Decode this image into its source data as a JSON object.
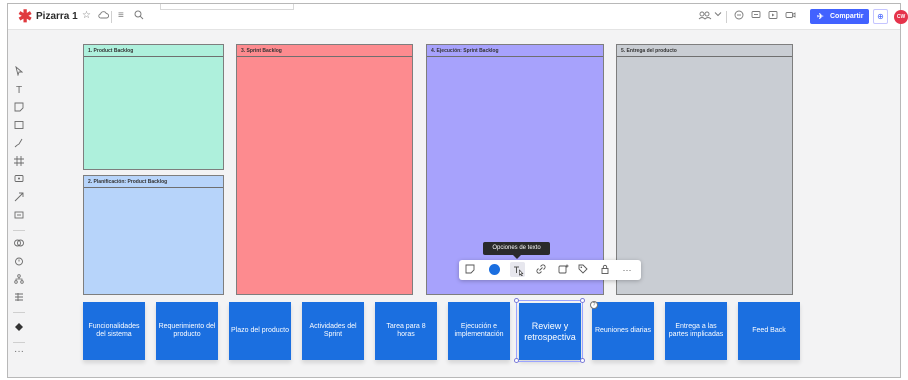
{
  "app": {
    "board_title": "Pizarra 1",
    "share_label": "Compartir",
    "avatar_initials": "CW",
    "accent_color": "#4262ff",
    "logo_icon": "asterisk-logo"
  },
  "topbar_icons": [
    "star-icon",
    "cloud-icon",
    "menu-icon",
    "search-icon"
  ],
  "topbar_right_icons": [
    "reactions-icon",
    "chevron-down-icon",
    "comment-icon",
    "chat-icon",
    "present-icon",
    "screen-icon"
  ],
  "left_tools": [
    "select-icon",
    "text-icon",
    "sticky-note-icon",
    "shape-icon",
    "pen-icon",
    "frame-icon",
    "comment-icon",
    "connector-icon",
    "template-icon",
    "link-icon",
    "timer-icon",
    "mindmap-icon",
    "table-icon",
    "apps-icon",
    "more-icon"
  ],
  "columns": [
    {
      "title": "1. Product Backlog",
      "color": "#aef0dc"
    },
    {
      "title": "2. Planificación: Product Backlog",
      "color": "#b7d4fa"
    },
    {
      "title": "3. Sprint Backlog",
      "color": "#fd8b8f"
    },
    {
      "title": "4. Ejecución: Sprint Backlog",
      "color": "#a7a2fc"
    },
    {
      "title": "5. Entrega del producto",
      "color": "#c9cdd3"
    }
  ],
  "stickies": [
    {
      "label": "Funcionalidades del sistema"
    },
    {
      "label": "Requerimiento del producto"
    },
    {
      "label": "Plazo del producto"
    },
    {
      "label": "Actividades del Sprint"
    },
    {
      "label": "Tarea para 8 horas"
    },
    {
      "label": "Ejecución e implementación"
    },
    {
      "label": "Review y retrospectiva"
    },
    {
      "label": "Reuniones diarias"
    },
    {
      "label": "Entrega a las partes implicadas"
    },
    {
      "label": "Feed Back"
    }
  ],
  "context_toolbar": {
    "tooltip": "Opciones de texto",
    "sticky_color": "#1b6fe0",
    "items": [
      "sticky-shape-icon",
      "color-icon",
      "text-options-icon",
      "link-icon",
      "add-reaction-icon",
      "tag-icon",
      "lock-icon",
      "more-icon"
    ]
  }
}
